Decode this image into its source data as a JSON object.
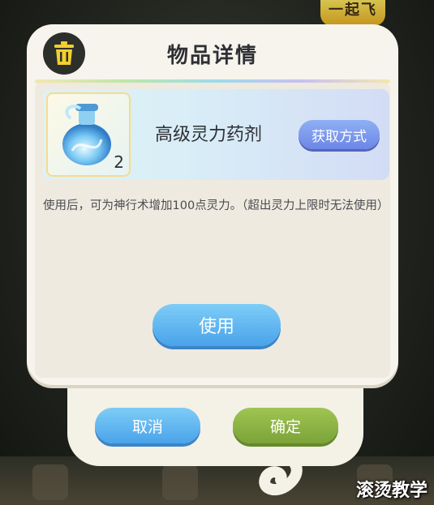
{
  "background": {
    "logo_text": "一起飞"
  },
  "dialog": {
    "title": "物品详情",
    "icons": {
      "delete": "trash-icon",
      "item": "potion-flask-icon"
    },
    "item": {
      "name": "高级灵力药剂",
      "count": "2",
      "obtain_label": "获取方式"
    },
    "description": "使用后，可为神行术增加100点灵力。（超出灵力上限时无法使用）",
    "use_label": "使用"
  },
  "footer": {
    "cancel_label": "取消",
    "confirm_label": "确定"
  },
  "watermark": "滚烫教学",
  "colors": {
    "accent_blue": "#4aa3ea",
    "confirm_green": "#7ba338",
    "panel_cream": "#f6f4ec"
  }
}
